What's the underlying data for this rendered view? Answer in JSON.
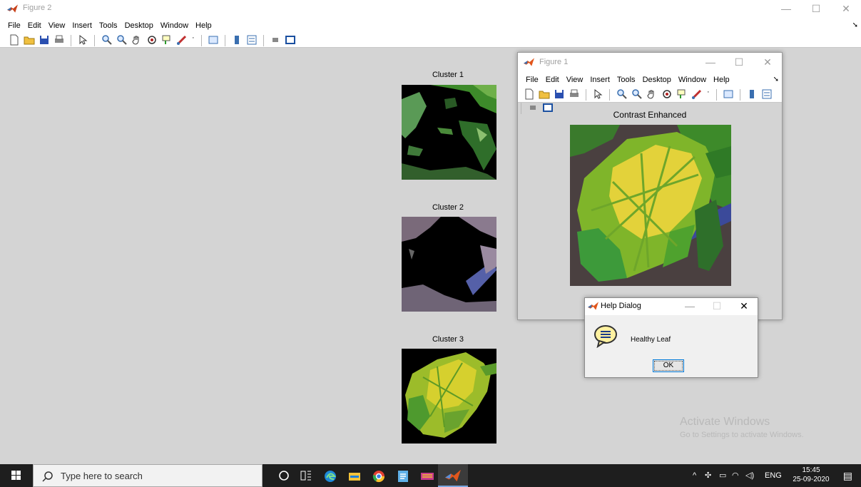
{
  "figure2": {
    "title": "Figure 2",
    "menu": [
      "File",
      "Edit",
      "View",
      "Insert",
      "Tools",
      "Desktop",
      "Window",
      "Help"
    ],
    "clusters": [
      {
        "title": "Cluster 1"
      },
      {
        "title": "Cluster 2"
      },
      {
        "title": "Cluster 3"
      }
    ]
  },
  "figure1": {
    "title": "Figure 1",
    "menu": [
      "File",
      "Edit",
      "View",
      "Insert",
      "Tools",
      "Desktop",
      "Window",
      "Help"
    ],
    "axes_title": "Contrast Enhanced"
  },
  "help_dialog": {
    "title": "Help Dialog",
    "message": "Healthy Leaf",
    "ok_label": "OK"
  },
  "watermark": {
    "line1": "Activate Windows",
    "line2": "Go to Settings to activate Windows."
  },
  "taskbar": {
    "search_placeholder": "Type here to search",
    "language": "ENG",
    "time": "15:45",
    "date": "25-09-2020"
  },
  "icons": {
    "matlab": "matlab-icon",
    "help": "speech-bubble-info-icon",
    "start": "windows-start-icon",
    "search": "search-icon"
  }
}
